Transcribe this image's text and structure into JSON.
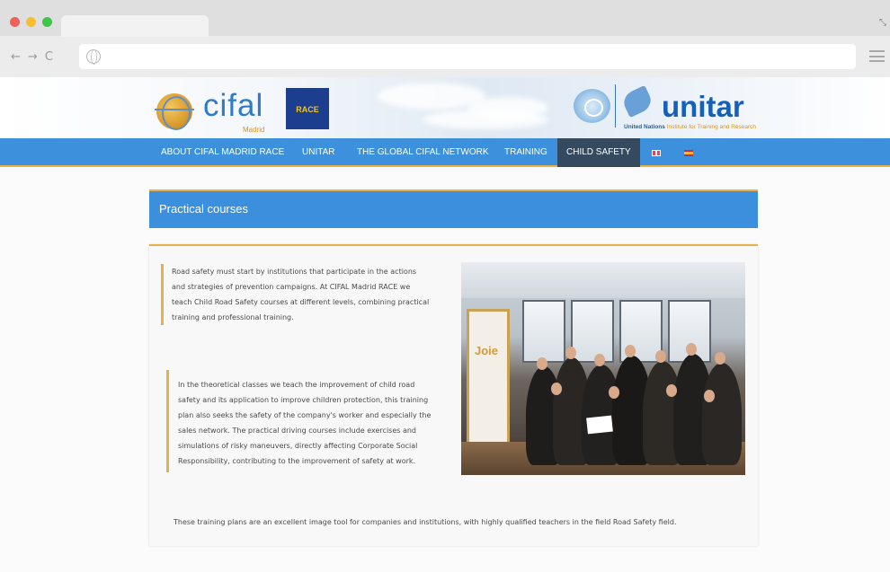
{
  "browser": {
    "nav_buttons": [
      "←",
      "→",
      "C"
    ],
    "url": ""
  },
  "header": {
    "cifal_logo_text": "cifal",
    "cifal_logo_subtext": "Madrid",
    "race_logo_text": "RACE",
    "unitar_logo_text": "unitar",
    "unitar_subtitle_bold": "United Nations",
    "unitar_subtitle": "Institute for Training and Research"
  },
  "nav": {
    "items": [
      {
        "label": "ABOUT CIFAL MADRID RACE"
      },
      {
        "label": "UNITAR"
      },
      {
        "label": "THE GLOBAL CIFAL NETWORK"
      },
      {
        "label": "TRAINING"
      },
      {
        "label": "CHILD SAFETY",
        "active": true
      }
    ],
    "languages": [
      "English",
      "Español"
    ]
  },
  "section": {
    "title": "Practical courses"
  },
  "content": {
    "paragraph_1": "Road safety must start by institutions that participate in the actions and strategies of prevention campaigns. At CIFAL Madrid RACE we teach Child Road Safety courses at different levels, combining practical training and professional training.",
    "paragraph_2": "In the theoretical classes we teach the improvement of child road safety and its application to improve children protection, this training plan also seeks the safety of the company's worker and especially the sales network. The practical driving courses include exercises and simulations of risky maneuvers, directly affecting Corporate Social Responsibility, contributing to the improvement of safety at work.",
    "paragraph_3": "These training plans are an excellent image tool for companies and institutions, with highly qualified teachers in the field Road Safety field.",
    "photo_banner_text": "Joie"
  },
  "colors": {
    "nav_blue": "#3d91dc",
    "nav_active": "#354a5f",
    "accent_gold": "#e6b14c",
    "logo_blue": "#2e7cc8"
  }
}
